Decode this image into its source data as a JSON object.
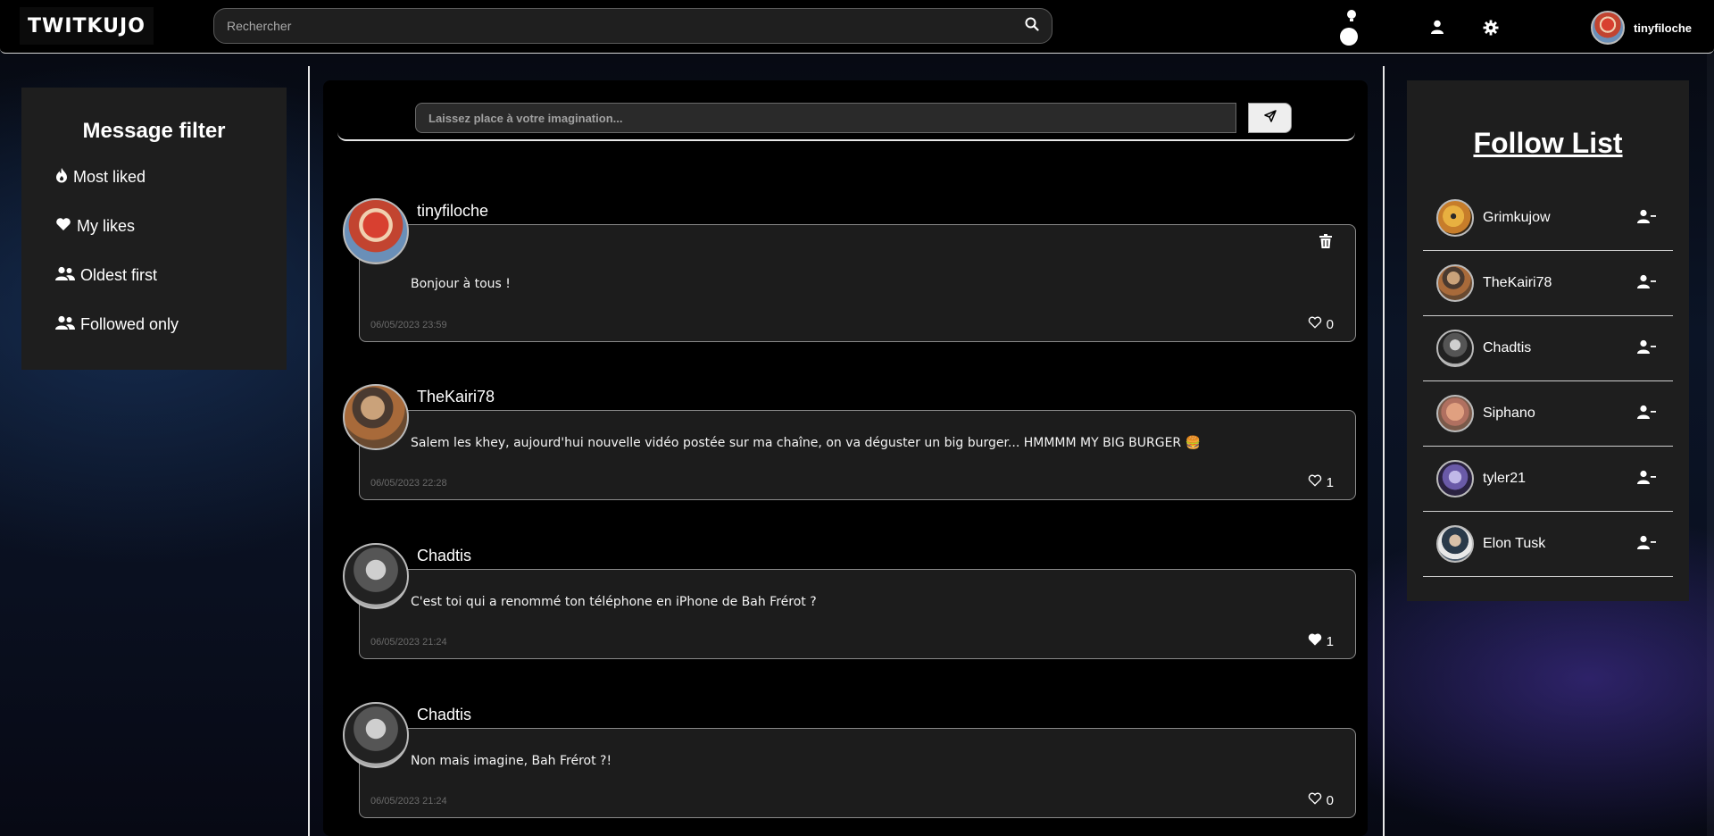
{
  "header": {
    "logo": "TWITKUJO",
    "search_placeholder": "Rechercher",
    "username": "tinyfiloche"
  },
  "filters": {
    "title": "Message filter",
    "items": [
      {
        "label": "Most liked",
        "icon": "fire-icon"
      },
      {
        "label": "My likes",
        "icon": "heart-icon"
      },
      {
        "label": "Oldest first",
        "icon": "users-icon"
      },
      {
        "label": "Followed only",
        "icon": "users-icon"
      }
    ]
  },
  "composer": {
    "placeholder": "Laissez place à votre imagination..."
  },
  "posts": [
    {
      "author": "tinyfiloche",
      "text": "Bonjour à tous !",
      "date": "06/05/2023 23:59",
      "likes": "0",
      "liked": false,
      "deletable": true
    },
    {
      "author": "TheKairi78",
      "text": "Salem les khey, aujourd'hui nouvelle vidéo postée sur ma chaîne, on va déguster un big burger... HMMMM MY BIG BURGER 🍔",
      "date": "06/05/2023 22:28",
      "likes": "1",
      "liked": false,
      "deletable": false
    },
    {
      "author": "Chadtis",
      "text": "C'est toi qui a renommé ton téléphone en iPhone de Bah Frérot ?",
      "date": "06/05/2023 21:24",
      "likes": "1",
      "liked": true,
      "deletable": false
    },
    {
      "author": "Chadtis",
      "text": "Non mais imagine, Bah Frérot ?!",
      "date": "06/05/2023 21:24",
      "likes": "0",
      "liked": false,
      "deletable": false
    }
  ],
  "follow": {
    "title": "Follow List",
    "items": [
      {
        "name": "Grimkujow"
      },
      {
        "name": "TheKairi78"
      },
      {
        "name": "Chadtis"
      },
      {
        "name": "Siphano"
      },
      {
        "name": "tyler21"
      },
      {
        "name": "Elon Tusk"
      }
    ]
  }
}
